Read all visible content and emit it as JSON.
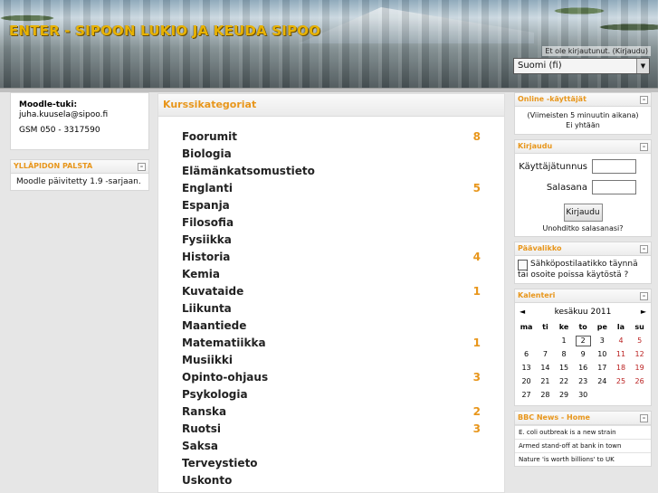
{
  "header": {
    "site_title": "ENTER - SIPOON LUKIO JA KEUDA SIPOO",
    "login_status": "Et ole kirjautunut. (Kirjaudu)",
    "language": "Suomi (fi)"
  },
  "left": {
    "support": {
      "title": "Moodle-tuki:",
      "email": "juha.kuusela@sipoo.fi",
      "phone": "GSM 050 - 3317590"
    },
    "admin_block": {
      "title": "YLLÄPIDON PALSTA",
      "text": "Moodle päivitetty 1.9 -sarjaan."
    }
  },
  "main": {
    "title": "Kurssikategoriat",
    "categories": [
      {
        "name": "Foorumit",
        "count": "8"
      },
      {
        "name": "Biologia",
        "count": ""
      },
      {
        "name": "Elämänkatsomustieto",
        "count": ""
      },
      {
        "name": "Englanti",
        "count": "5"
      },
      {
        "name": "Espanja",
        "count": ""
      },
      {
        "name": "Filosofia",
        "count": ""
      },
      {
        "name": "Fysiikka",
        "count": ""
      },
      {
        "name": "Historia",
        "count": "4"
      },
      {
        "name": "Kemia",
        "count": ""
      },
      {
        "name": "Kuvataide",
        "count": "1"
      },
      {
        "name": "Liikunta",
        "count": ""
      },
      {
        "name": "Maantiede",
        "count": ""
      },
      {
        "name": "Matematiikka",
        "count": "1"
      },
      {
        "name": "Musiikki",
        "count": ""
      },
      {
        "name": "Opinto-ohjaus",
        "count": "3"
      },
      {
        "name": "Psykologia",
        "count": ""
      },
      {
        "name": "Ranska",
        "count": "2"
      },
      {
        "name": "Ruotsi",
        "count": "3"
      },
      {
        "name": "Saksa",
        "count": ""
      },
      {
        "name": "Terveystieto",
        "count": ""
      },
      {
        "name": "Uskonto",
        "count": ""
      }
    ]
  },
  "right": {
    "online": {
      "title": "Online -käyttäjät",
      "note": "(Viimeisten 5 minuutin aikana)",
      "none": "Ei yhtään"
    },
    "login": {
      "title": "Kirjaudu",
      "username_label": "Käyttäjätunnus",
      "password_label": "Salasana",
      "button": "Kirjaudu",
      "forgot": "Unohditko salasanasi?"
    },
    "main_menu": {
      "title": "Päävalikko",
      "item": "Sähköpostilaatikko täynnä tai osoite poissa käytöstä ?"
    },
    "calendar": {
      "title": "Kalenteri",
      "prev": "◄",
      "next": "►",
      "month": "kesäkuu 2011",
      "weekdays": [
        "ma",
        "ti",
        "ke",
        "to",
        "pe",
        "la",
        "su"
      ],
      "weeks": [
        [
          "",
          "",
          "1",
          "2",
          "3",
          "4",
          "5"
        ],
        [
          "6",
          "7",
          "8",
          "9",
          "10",
          "11",
          "12"
        ],
        [
          "13",
          "14",
          "15",
          "16",
          "17",
          "18",
          "19"
        ],
        [
          "20",
          "21",
          "22",
          "23",
          "24",
          "25",
          "26"
        ],
        [
          "27",
          "28",
          "29",
          "30",
          "",
          "",
          ""
        ]
      ],
      "today": "2"
    },
    "news": {
      "title": "BBC News - Home",
      "items": [
        "E. coli outbreak is a new strain",
        "Armed stand-off at bank in town",
        "Nature 'is worth billions' to UK"
      ]
    }
  }
}
